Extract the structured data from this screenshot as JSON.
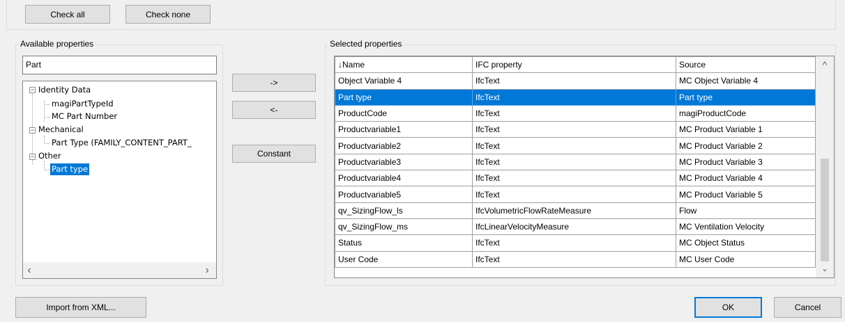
{
  "top_buttons": {
    "check_all": "Check all",
    "check_none": "Check none"
  },
  "available": {
    "group_label": "Available properties",
    "search_value": "Part",
    "tree": [
      {
        "label": "Identity Data",
        "level": 0,
        "expanded": true
      },
      {
        "label": "magiPartTypeId",
        "level": 1
      },
      {
        "label": "MC Part Number",
        "level": 1
      },
      {
        "label": "Mechanical",
        "level": 0,
        "expanded": true
      },
      {
        "label": "Part Type (FAMILY_CONTENT_PART_",
        "level": 1
      },
      {
        "label": "Other",
        "level": 0,
        "expanded": true
      },
      {
        "label": "Part type",
        "level": 1,
        "selected": true
      }
    ]
  },
  "middle_buttons": {
    "add": "->",
    "remove": "<-",
    "constant": "Constant"
  },
  "selected": {
    "group_label": "Selected properties",
    "columns": [
      "↓Name",
      "IFC property",
      "Source"
    ],
    "rows": [
      [
        "Object Variable 4",
        "IfcText",
        "MC Object Variable 4"
      ],
      [
        "Part type",
        "IfcText",
        "Part type"
      ],
      [
        "ProductCode",
        "IfcText",
        "magiProductCode"
      ],
      [
        "Productvariable1",
        "IfcText",
        "MC Product Variable 1"
      ],
      [
        "Productvariable2",
        "IfcText",
        "MC Product Variable 2"
      ],
      [
        "Productvariable3",
        "IfcText",
        "MC Product Variable 3"
      ],
      [
        "Productvariable4",
        "IfcText",
        "MC Product Variable 4"
      ],
      [
        "Productvariable5",
        "IfcText",
        "MC Product Variable 5"
      ],
      [
        "qv_SizingFlow_ls",
        "IfcVolumetricFlowRateMeasure",
        "Flow"
      ],
      [
        "qv_SizingFlow_ms",
        "IfcLinearVelocityMeasure",
        "MC Ventilation Velocity"
      ],
      [
        "Status",
        "IfcText",
        "MC Object Status"
      ],
      [
        "User Code",
        "IfcText",
        "MC User Code"
      ]
    ],
    "selected_row": 1
  },
  "bottom_buttons": {
    "import": "Import from XML...",
    "ok": "OK",
    "cancel": "Cancel"
  },
  "colors": {
    "selection": "#0078d7",
    "background": "#f0f0f0"
  }
}
